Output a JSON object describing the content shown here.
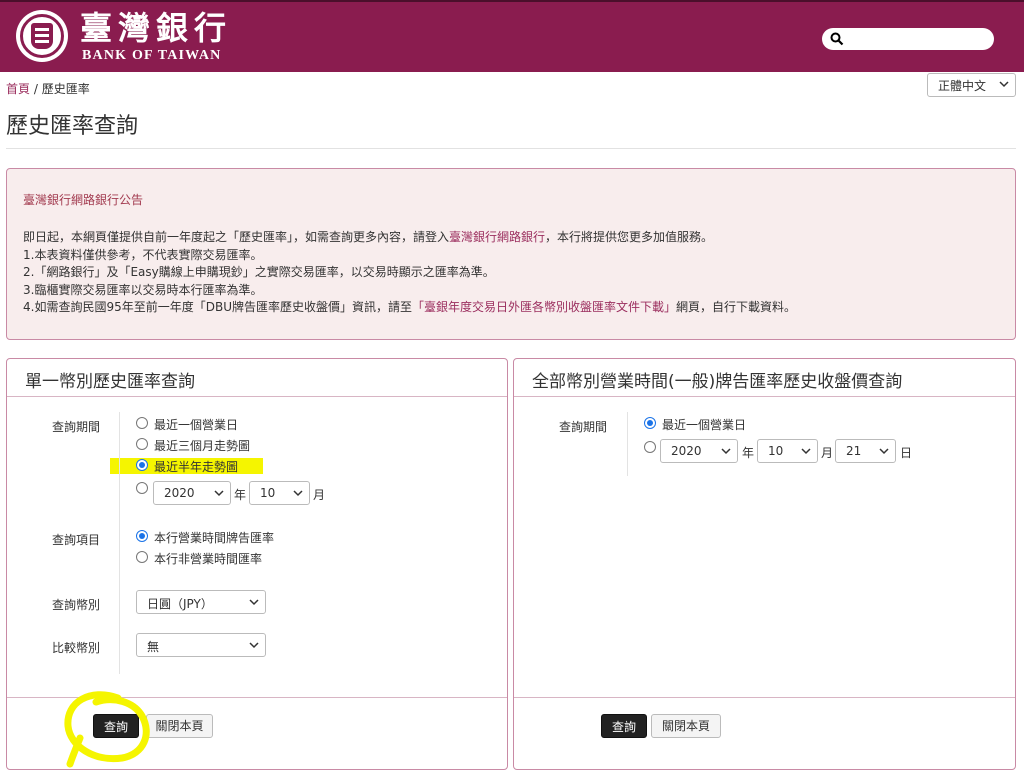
{
  "header": {
    "logo_cn": "臺灣銀行",
    "logo_en": "BANK OF TAIWAN",
    "search_placeholder": ""
  },
  "breadcrumb": {
    "home": "首頁",
    "separator": " / ",
    "current": "歷史匯率"
  },
  "language": {
    "selected": "正體中文"
  },
  "page_title": "歷史匯率查詢",
  "notice": {
    "title": "臺灣銀行網路銀行公告",
    "line1_a": "即日起，本網頁僅提供自前一年度起之「歷史匯率」，如需查詢更多內容，請登入",
    "line1_link": "臺灣銀行網路銀行",
    "line1_b": "，本行將提供您更多加值服務。",
    "line2": "1.本表資料僅供參考，不代表實際交易匯率。",
    "line3": "2.「網路銀行」及「Easy購線上申購現鈔」之實際交易匯率，以交易時顯示之匯率為準。",
    "line4": "3.臨櫃實際交易匯率以交易時本行匯率為準。",
    "line5_a": "4.如需查詢民國95年至前一年度「DBU牌告匯率歷史收盤價」資訊，請至",
    "line5_link": "「臺銀年度交易日外匯各幣別收盤匯率文件下載」",
    "line5_b": "網頁，自行下載資料。"
  },
  "left_panel": {
    "title": "單一幣別歷史匯率查詢",
    "period_label": "查詢期間",
    "period_options": [
      "最近一個營業日",
      "最近三個月走勢圖",
      "最近半年走勢圖"
    ],
    "period_selected_index": 2,
    "year_value": "2020",
    "year_unit": "年",
    "month_value": "10",
    "month_unit": "月",
    "item_label": "查詢項目",
    "item_options": [
      "本行營業時間牌告匯率",
      "本行非營業時間匯率"
    ],
    "item_selected_index": 0,
    "currency_label": "查詢幣別",
    "currency_value": "日圓（JPY）",
    "compare_label": "比較幣別",
    "compare_value": "無",
    "query_button": "查詢",
    "close_button": "關閉本頁"
  },
  "right_panel": {
    "title": "全部幣別營業時間(一般)牌告匯率歷史收盤價查詢",
    "period_label": "查詢期間",
    "period_option": "最近一個營業日",
    "year_value": "2020",
    "year_unit": "年",
    "month_value": "10",
    "month_unit": "月",
    "day_value": "21",
    "day_unit": "日",
    "query_button": "查詢",
    "close_button": "關閉本頁"
  },
  "colors": {
    "brand": "#8a1c4f",
    "link": "#9b2e5e",
    "radio_selected": "#1a73e8",
    "annotation_highlight": "#f5f500"
  }
}
